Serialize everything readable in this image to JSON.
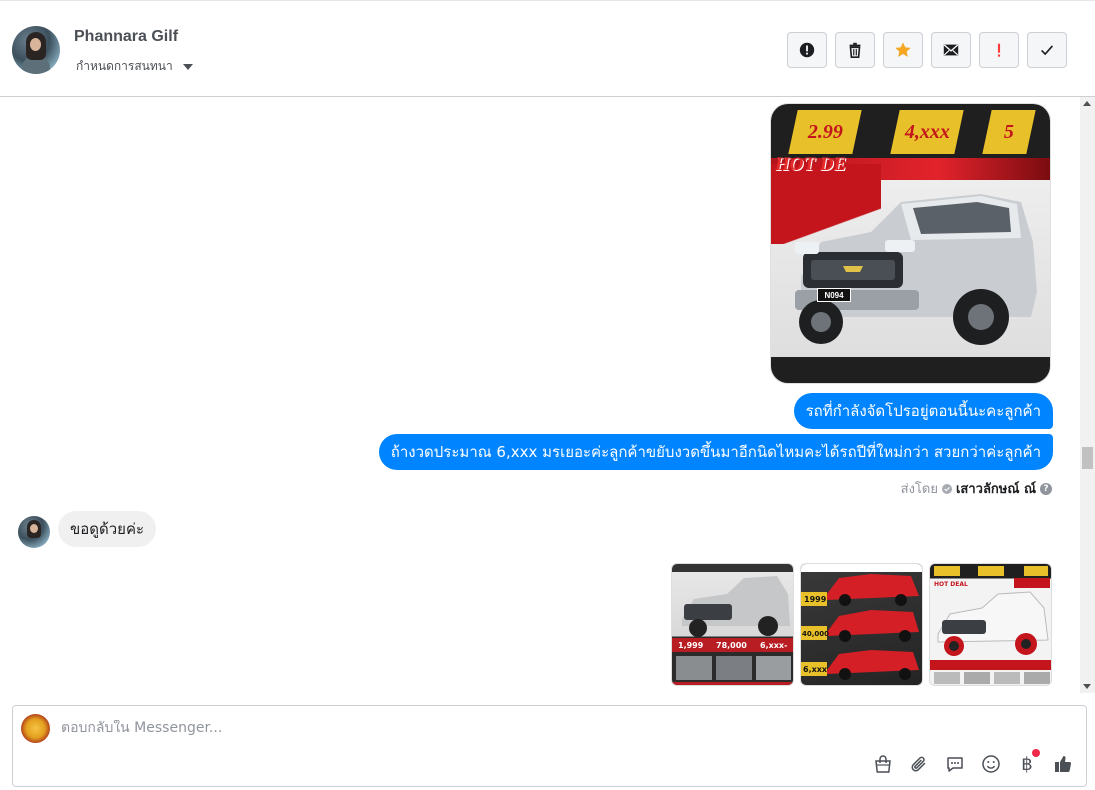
{
  "contact": {
    "name": "Phannara Gilf",
    "assign_label": "กำหนดการสนทนา"
  },
  "toolbar": {
    "buttons": [
      {
        "name": "report-spam",
        "icon": "exclamation-circle-icon"
      },
      {
        "name": "delete",
        "icon": "trash-icon"
      },
      {
        "name": "star",
        "icon": "star-icon",
        "color": "#f5a623"
      },
      {
        "name": "mark-unread",
        "icon": "envelope-icon"
      },
      {
        "name": "follow-up",
        "icon": "exclamation-icon",
        "color": "#fa3e3e"
      },
      {
        "name": "mark-done",
        "icon": "check-icon"
      }
    ]
  },
  "conversation": {
    "car_ad": {
      "badge_1": "2.99",
      "badge_2": "4,xxx",
      "badge_3": "5",
      "headline": "HOT DE",
      "plate": "N094"
    },
    "outgoing_messages": [
      "รถที่กำลังจัดโปรอยู่ตอนนี้นะคะลูกค้า",
      "ถ้างวดประมาณ 6,xxx มรเยอะค่ะลูกค้าขยับงวดขึ้นมาอีกนิดไหมคะได้รถปีที่ใหม่กว่า สวยกว่าค่ะลูกค้า"
    ],
    "sent_by_label": "ส่งโดย",
    "sent_by_name": "เสาวลักษณ์ ณ์",
    "incoming_message": "ขอดูด้วยค่ะ",
    "thumbnails": [
      {
        "name": "vigo-silver-thumbnail",
        "caption": "1,999  78,000  6,xxx"
      },
      {
        "name": "colorado-red-thumbnail",
        "caption": "1999  40,000  6,xxx"
      },
      {
        "name": "colorado-white-thumbnail",
        "caption": "HOT DEAL"
      }
    ]
  },
  "composer": {
    "placeholder": "ตอบกลับใน Messenger...",
    "tools": [
      "bag-icon",
      "paperclip-icon",
      "speech-bubble-icon",
      "smiley-icon",
      "baht-icon",
      "thumbs-up-icon"
    ]
  },
  "colors": {
    "messenger_blue": "#0084ff",
    "incoming_bubble": "#f1f0f0",
    "star": "#f5a623",
    "alert_red": "#fa3e3e"
  }
}
